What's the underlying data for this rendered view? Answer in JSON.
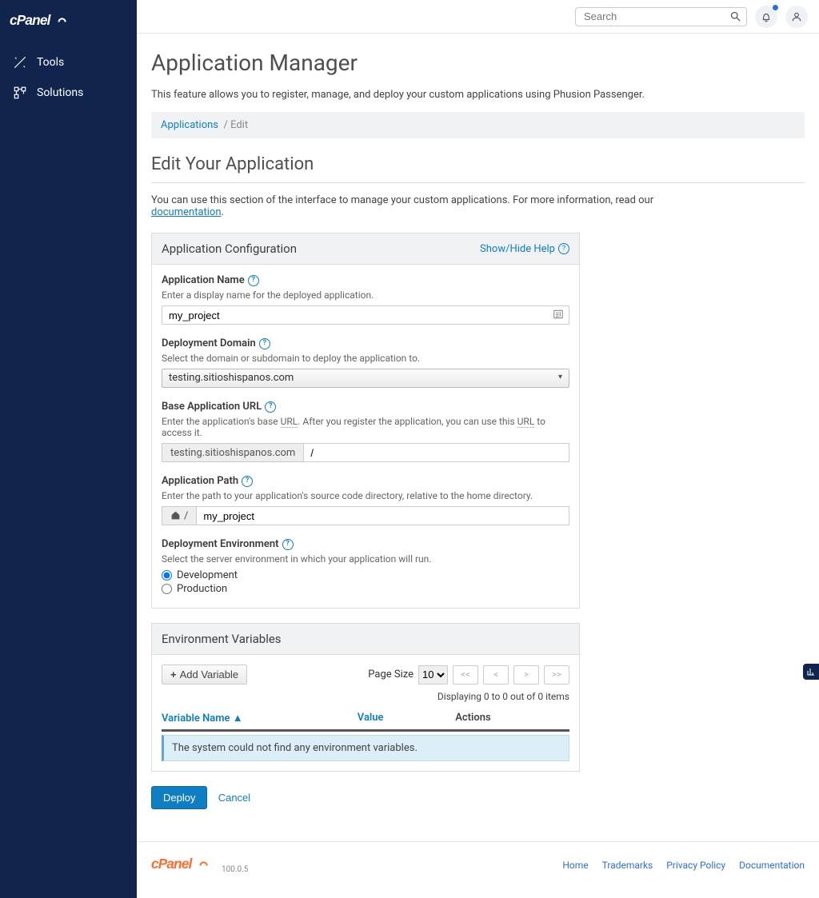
{
  "brand": "cPanel",
  "sidebar": {
    "tools": "Tools",
    "solutions": "Solutions"
  },
  "topbar": {
    "search_placeholder": "Search"
  },
  "page": {
    "title": "Application Manager",
    "intro": "This feature allows you to register, manage, and deploy your custom applications using Phusion Passenger.",
    "breadcrumb_applications": "Applications",
    "breadcrumb_edit": "Edit",
    "section_title": "Edit Your Application",
    "section_desc_before": "You can use this section of the interface to manage your custom applications. For more information, read our ",
    "section_desc_link": "documentation",
    "section_desc_after": "."
  },
  "config": {
    "panel_title": "Application Configuration",
    "help_toggle": "Show/Hide Help",
    "app_name_label": "Application Name",
    "app_name_help": "Enter a display name for the deployed application.",
    "app_name_value": "my_project",
    "dep_domain_label": "Deployment Domain",
    "dep_domain_help": "Select the domain or subdomain to deploy the application to.",
    "dep_domain_value": "testing.sitioshispanos.com",
    "base_url_label": "Base Application URL",
    "base_url_help_before": "Enter the application's base ",
    "base_url_help_abbr": "URL",
    "base_url_help_mid": ". After you register the application, you can use this ",
    "base_url_help_after": " to access it.",
    "base_url_prefix": "testing.sitioshispanos.com",
    "base_url_value": "/",
    "app_path_label": "Application Path",
    "app_path_help": "Enter the path to your application's source code directory, relative to the home directory.",
    "app_path_prefix": "/",
    "app_path_value": "my_project",
    "dep_env_label": "Deployment Environment",
    "dep_env_help": "Select the server environment in which your application will run.",
    "dep_env_options": {
      "dev": "Development",
      "prod": "Production"
    },
    "dep_env_selected": "dev"
  },
  "envvars": {
    "panel_title": "Environment Variables",
    "add_button": "Add Variable",
    "page_size_label": "Page Size",
    "page_size": "10",
    "pager_first": "<<",
    "pager_prev": "<",
    "pager_next": ">",
    "pager_last": ">>",
    "displaying": "Displaying 0 to 0 out of 0 items",
    "col_name": "Variable Name",
    "col_value": "Value",
    "col_actions": "Actions",
    "sort_indicator": "▲",
    "empty": "The system could not find any environment variables."
  },
  "actions": {
    "deploy": "Deploy",
    "cancel": "Cancel"
  },
  "footer": {
    "version": "100.0.5",
    "links": {
      "home": "Home",
      "trademarks": "Trademarks",
      "privacy": "Privacy Policy",
      "docs": "Documentation"
    }
  }
}
